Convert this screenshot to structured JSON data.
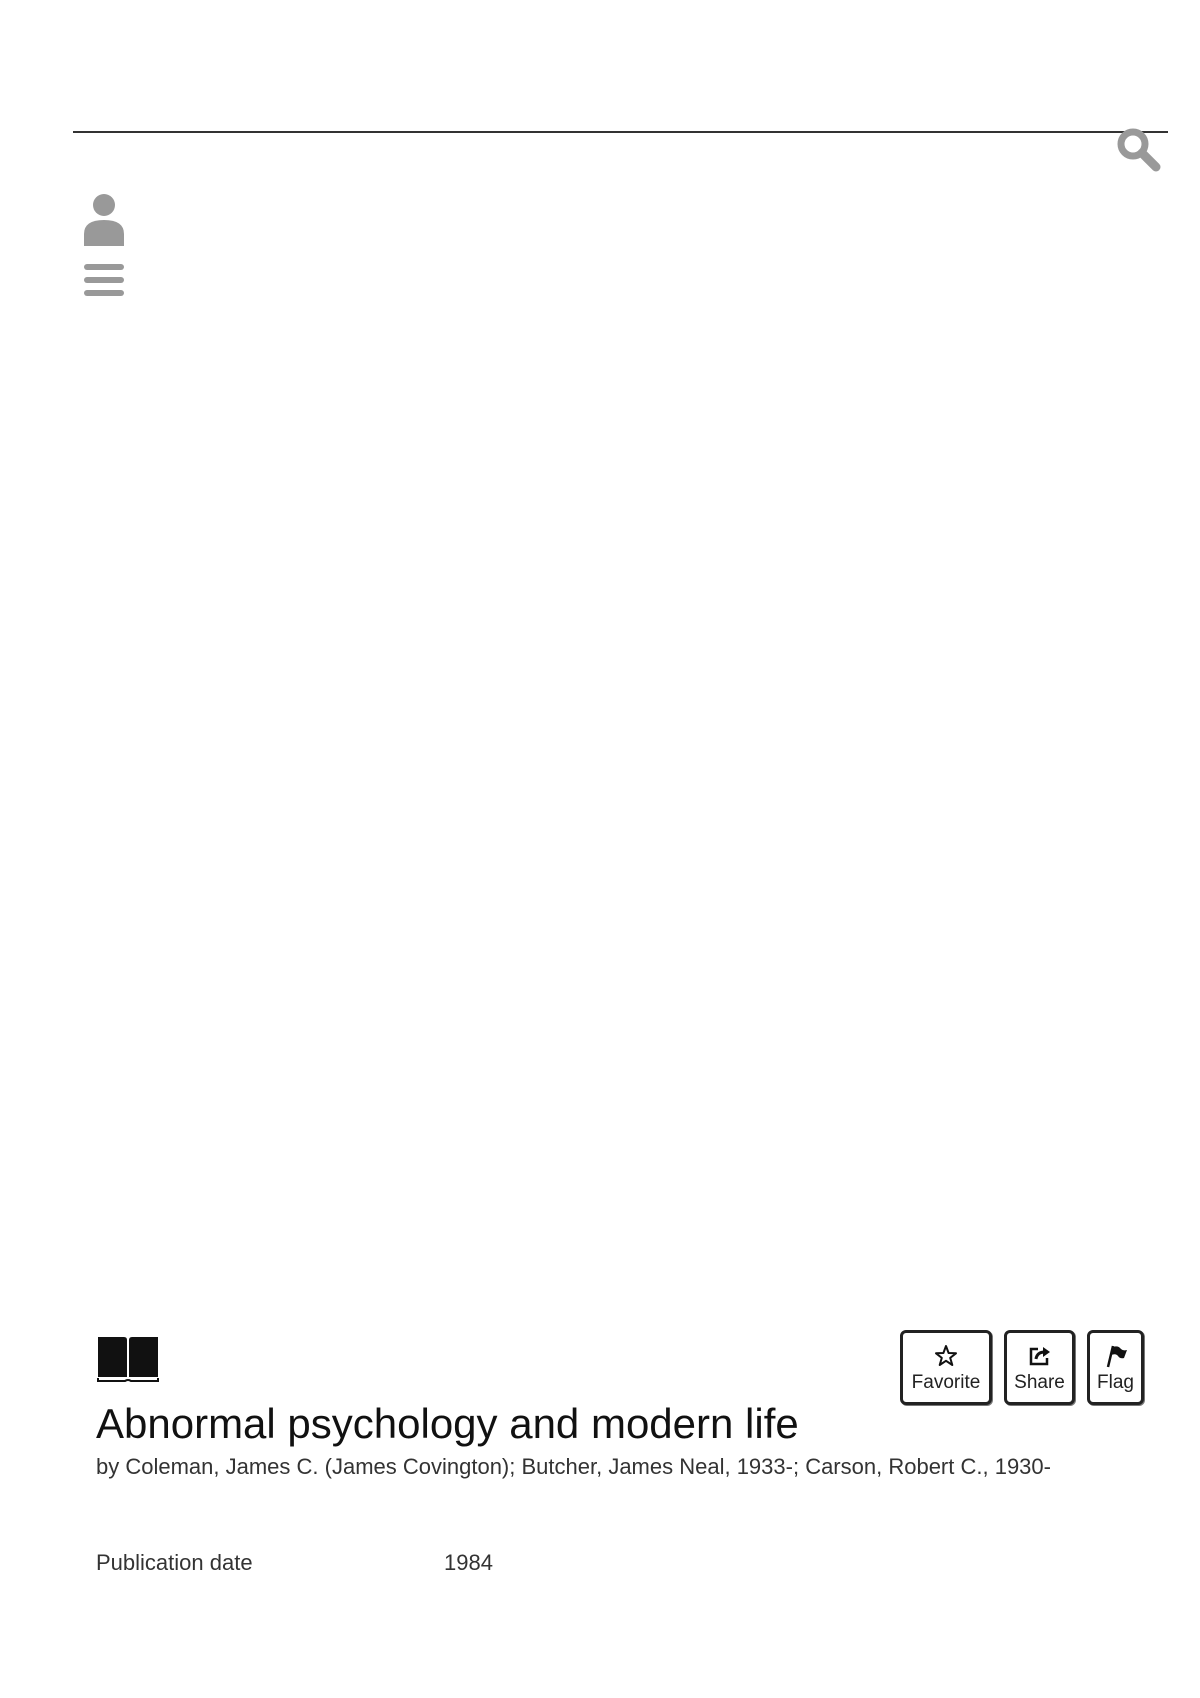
{
  "header": {
    "search": {
      "placeholder": "",
      "value": "",
      "icon": "search-icon"
    },
    "user_icon": "user-icon",
    "menu_icon": "hamburger-menu-icon"
  },
  "item": {
    "type_icon": "book-icon",
    "title": "Abnormal psychology and modern life",
    "byline": "by Coleman, James C. (James Covington); Butcher, James Neal, 1933-; Carson, Robert C., 1930-",
    "actions": [
      {
        "label": "Favorite",
        "icon": "star-icon"
      },
      {
        "label": "Share",
        "icon": "share-icon"
      },
      {
        "label": "Flag",
        "icon": "flag-icon"
      }
    ],
    "metadata": [
      {
        "key": "Publication date",
        "value": "1984"
      }
    ]
  },
  "colors": {
    "icon_gray": "#999999",
    "text": "#222222",
    "rule": "#333333"
  }
}
